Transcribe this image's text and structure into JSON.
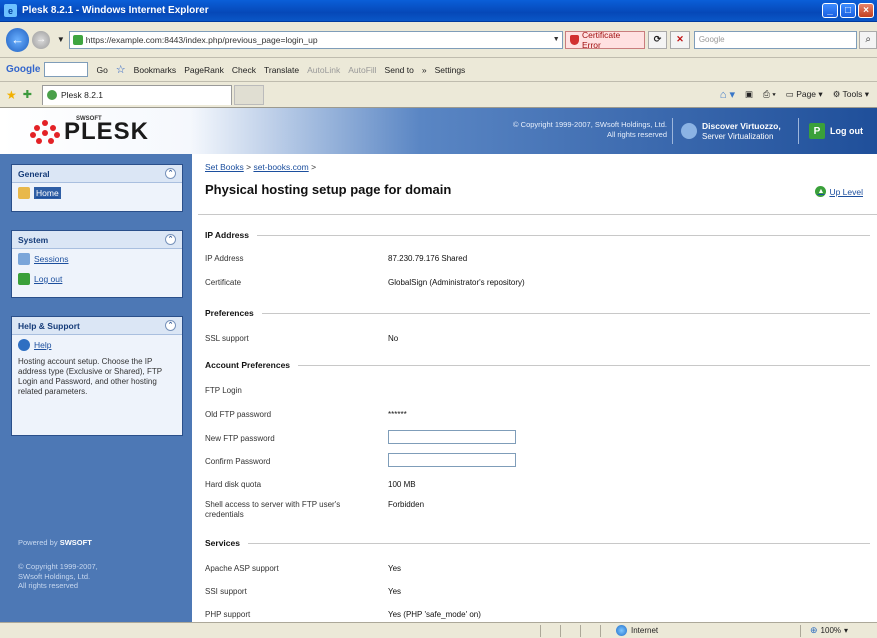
{
  "window": {
    "title": "Plesk 8.2.1 - Windows Internet Explorer"
  },
  "address": {
    "url": "https://example.com:8443/index.php/previous_page=login_up",
    "cert_error": "Certificate Error",
    "search_placeholder": "Google"
  },
  "google_toolbar": {
    "logo": "Google",
    "items": [
      "Go",
      "Bookmarks",
      "PageRank",
      "Check",
      "Translate",
      "AutoLink",
      "AutoFill",
      "Send to",
      "»",
      "Settings"
    ]
  },
  "tabbar": {
    "tab_label": "Plesk 8.2.1",
    "page_menu": "Page",
    "tools_menu": "Tools"
  },
  "plesk": {
    "brand_small": "SWSOFT",
    "brand": "PLESK",
    "copyright_top": [
      "© Copyright 1999-2007, SWsoft Holdings, Ltd.",
      "All rights reserved"
    ],
    "virtuozzo_title": "Discover Virtuozzo,",
    "virtuozzo_sub": "Server Virtualization",
    "logout": "Log out"
  },
  "sidebar": {
    "general": {
      "title": "General",
      "home": "Home"
    },
    "system": {
      "title": "System",
      "sessions": "Sessions",
      "logout": "Log out"
    },
    "help": {
      "title": "Help & Support",
      "help": "Help",
      "text": "Hosting account setup. Choose the IP address type (Exclusive or Shared), FTP Login and Password, and other hosting related parameters."
    },
    "powered_prefix": "Powered by",
    "powered_brand": "SWSOFT",
    "copyright": [
      "© Copyright 1999-2007,",
      "SWsoft Holdings, Ltd.",
      "All rights reserved"
    ]
  },
  "main": {
    "breadcrumb_1": "Set Books",
    "breadcrumb_sep": " > ",
    "breadcrumb_2": "set-books.com",
    "breadcrumb_tail": " >",
    "title": "Physical hosting setup page for domain",
    "up_level": "Up Level",
    "sections": {
      "ip": "IP Address",
      "preferences": "Preferences",
      "account": "Account Preferences",
      "services": "Services"
    },
    "rows": {
      "ip_address": {
        "label": "IP Address",
        "value": "87.230.79.176 Shared"
      },
      "certificate": {
        "label": "Certificate",
        "value": "GlobalSign (Administrator's repository)"
      },
      "ssl": {
        "label": "SSL support",
        "value": "No"
      },
      "ftp_login": {
        "label": "FTP Login",
        "value": ""
      },
      "old_ftp": {
        "label": "Old FTP password",
        "value": "******"
      },
      "new_ftp": {
        "label": "New FTP password",
        "value": ""
      },
      "confirm": {
        "label": "Confirm Password",
        "value": ""
      },
      "quota": {
        "label": "Hard disk quota",
        "value": "100 MB"
      },
      "shell": {
        "label": "Shell access to server with FTP user's credentials",
        "value": "Forbidden"
      },
      "asp": {
        "label": "Apache ASP support",
        "value": "Yes"
      },
      "ssi": {
        "label": "SSI support",
        "value": "Yes"
      },
      "php": {
        "label": "PHP support",
        "value": "Yes (PHP 'safe_mode' on)"
      }
    }
  },
  "statusbar": {
    "zone": "Internet",
    "zoom": "100%"
  },
  "colors": {
    "sidebar_bg": "#4d78b5",
    "title_bar": "#0a5fd8",
    "link": "#1c4f9e"
  }
}
